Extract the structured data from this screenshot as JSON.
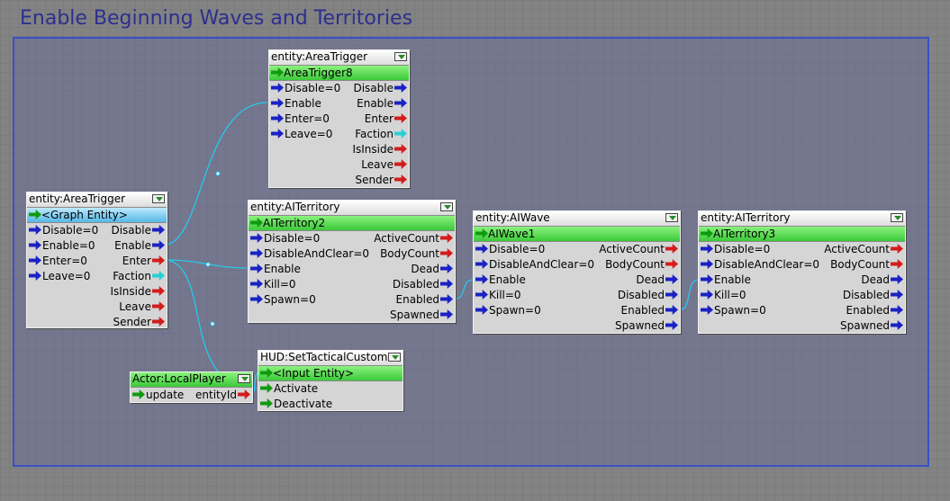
{
  "graph": {
    "title": "Enable Beginning Waves and Territories"
  },
  "colors": {
    "wire": "#28c8ee",
    "frame": "#3d4fc4",
    "title": "#2c2f8f"
  },
  "nodes": {
    "area_trigger_main": {
      "header": "entity:AreaTrigger",
      "entity": "<Graph Entity>",
      "rows": [
        {
          "in": "Disable=0",
          "out": "Disable"
        },
        {
          "in": "Enable=0",
          "out": "Enable"
        },
        {
          "in": "Enter=0",
          "out": "Enter"
        },
        {
          "in": "Leave=0",
          "out": "Faction"
        },
        {
          "out": "IsInside"
        },
        {
          "out": "Leave"
        },
        {
          "out": "Sender"
        }
      ]
    },
    "area_trigger_8": {
      "header": "entity:AreaTrigger",
      "entity": "AreaTrigger8",
      "rows": [
        {
          "in": "Disable=0",
          "out": "Disable"
        },
        {
          "in": "Enable",
          "out": "Enable"
        },
        {
          "in": "Enter=0",
          "out": "Enter"
        },
        {
          "in": "Leave=0",
          "out": "Faction"
        },
        {
          "out": "IsInside"
        },
        {
          "out": "Leave"
        },
        {
          "out": "Sender"
        }
      ]
    },
    "ai_territory_2": {
      "header": "entity:AITerritory",
      "entity": "AITerritory2",
      "rows": [
        {
          "in": "Disable=0",
          "out": "ActiveCount"
        },
        {
          "in": "DisableAndClear=0",
          "out": "BodyCount"
        },
        {
          "in": "Enable",
          "out": "Dead"
        },
        {
          "in": "Kill=0",
          "out": "Disabled"
        },
        {
          "in": "Spawn=0",
          "out": "Enabled"
        },
        {
          "out": "Spawned"
        }
      ]
    },
    "ai_wave_1": {
      "header": "entity:AIWave",
      "entity": "AIWave1",
      "rows": [
        {
          "in": "Disable=0",
          "out": "ActiveCount"
        },
        {
          "in": "DisableAndClear=0",
          "out": "BodyCount"
        },
        {
          "in": "Enable",
          "out": "Dead"
        },
        {
          "in": "Kill=0",
          "out": "Disabled"
        },
        {
          "in": "Spawn=0",
          "out": "Enabled"
        },
        {
          "out": "Spawned"
        }
      ]
    },
    "ai_territory_3": {
      "header": "entity:AITerritory",
      "entity": "AITerritory3",
      "rows": [
        {
          "in": "Disable=0",
          "out": "ActiveCount"
        },
        {
          "in": "DisableAndClear=0",
          "out": "BodyCount"
        },
        {
          "in": "Enable",
          "out": "Dead"
        },
        {
          "in": "Kill=0",
          "out": "Disabled"
        },
        {
          "in": "Spawn=0",
          "out": "Enabled"
        },
        {
          "out": "Spawned"
        }
      ]
    },
    "hud_set_tactical": {
      "header": "HUD:SetTacticalCustom",
      "entity": "<Input Entity>",
      "rows": [
        {
          "in": "Activate"
        },
        {
          "in": "Deactivate"
        }
      ]
    },
    "actor_local_player": {
      "header": "Actor:LocalPlayer",
      "rows": [
        {
          "in": "update",
          "out": "entityId"
        }
      ]
    }
  }
}
